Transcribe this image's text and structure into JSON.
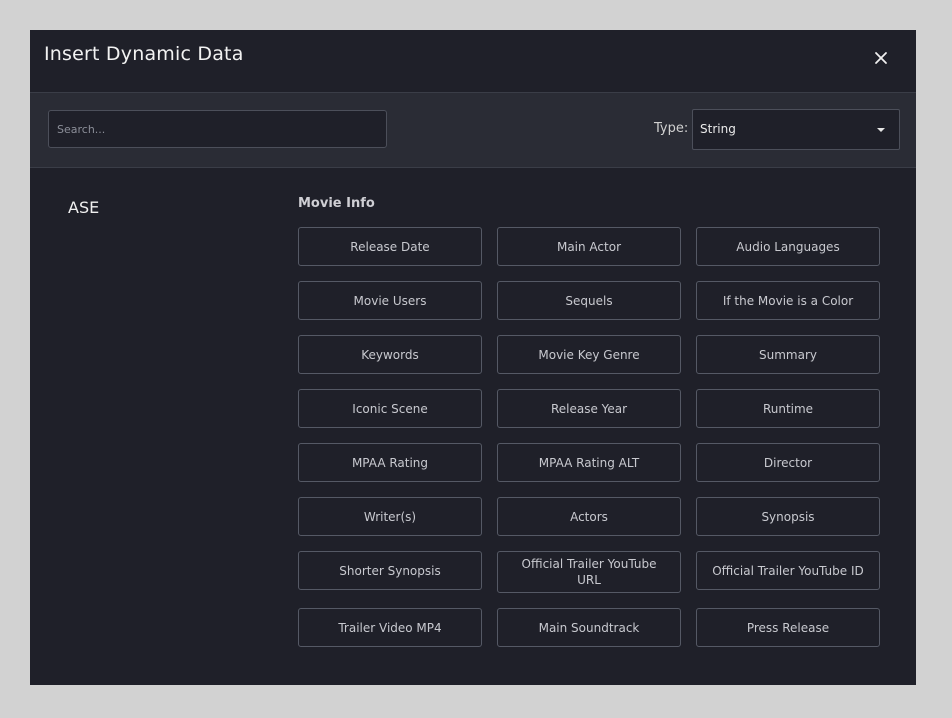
{
  "modal": {
    "title": "Insert Dynamic Data"
  },
  "toolbar": {
    "search_placeholder": "Search...",
    "type_label": "Type:",
    "type_value": "String"
  },
  "sidebar": {
    "items": [
      {
        "label": "ASE"
      }
    ]
  },
  "section": {
    "title": "Movie Info",
    "fields": [
      "Release Date",
      "Main Actor",
      "Audio Languages",
      "Movie Users",
      "Sequels",
      "If the Movie is a Color",
      "Keywords",
      "Movie Key Genre",
      "Summary",
      "Iconic Scene",
      "Release Year",
      "Runtime",
      "MPAA Rating",
      "MPAA Rating ALT",
      "Director",
      "Writer(s)",
      "Actors",
      "Synopsis",
      "Shorter Synopsis",
      "Official Trailer YouTube URL",
      "Official Trailer YouTube ID",
      "Trailer Video MP4",
      "Main Soundtrack",
      "Press Release"
    ]
  },
  "icons": {
    "close": "close-icon",
    "caret": "chevron-down-icon"
  },
  "colors": {
    "modal_bg": "#1f2029",
    "toolbar_bg": "#2a2c35",
    "border": "#555965",
    "backdrop": "#d2d2d2"
  }
}
